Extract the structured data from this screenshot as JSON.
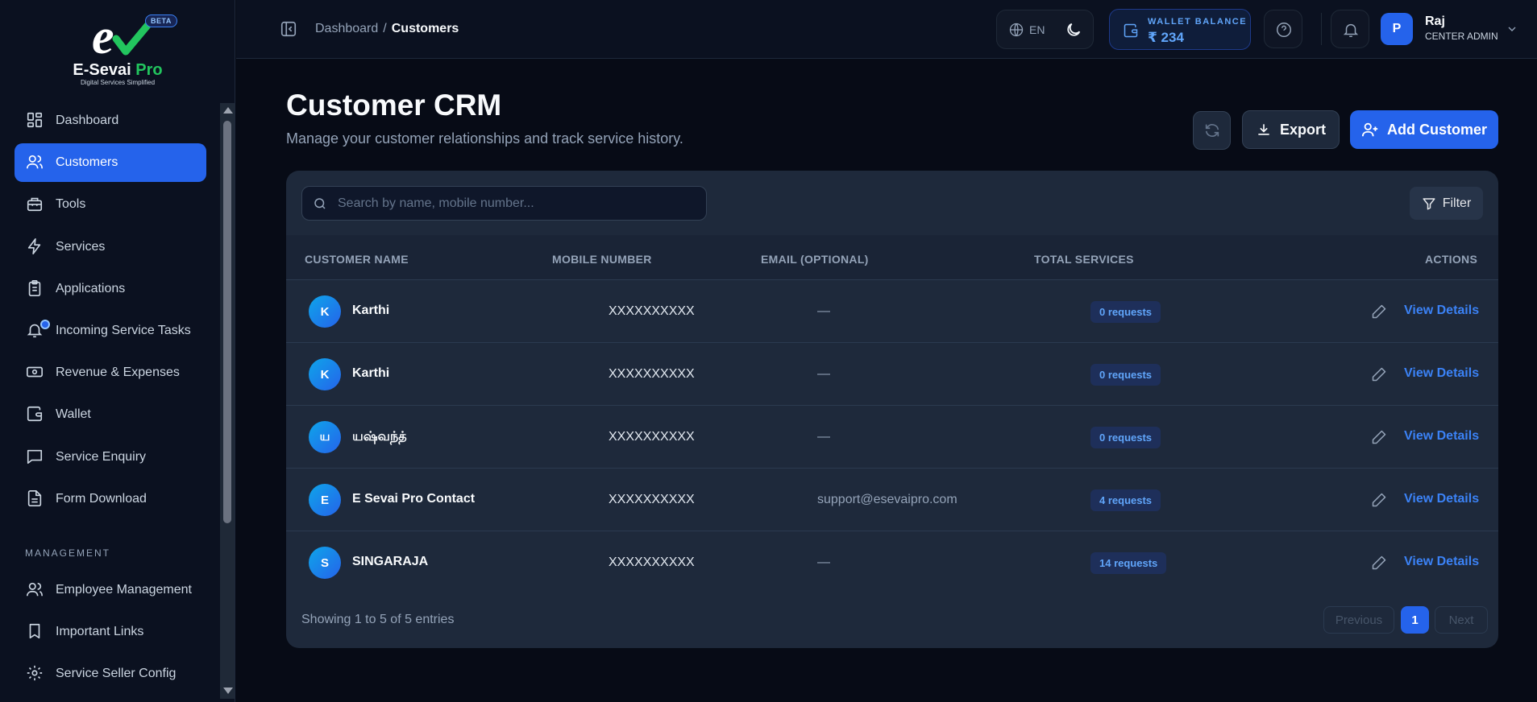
{
  "brand": {
    "name": "E-Sevai",
    "name_suffix": "Pro",
    "tagline": "Digital Services Simplified",
    "badge": "BETA",
    "accent": "#2563eb",
    "green": "#22c55e"
  },
  "sidebar": {
    "items": [
      {
        "label": "Dashboard",
        "icon": "dashboard-icon"
      },
      {
        "label": "Customers",
        "icon": "users-icon",
        "active": true
      },
      {
        "label": "Tools",
        "icon": "toolbox-icon"
      },
      {
        "label": "Services",
        "icon": "bolt-icon"
      },
      {
        "label": "Applications",
        "icon": "clipboard-icon"
      },
      {
        "label": "Incoming Service Tasks",
        "icon": "bell-icon",
        "has_dot": true
      },
      {
        "label": "Revenue & Expenses",
        "icon": "banknote-icon"
      },
      {
        "label": "Wallet",
        "icon": "wallet-icon"
      },
      {
        "label": "Service Enquiry",
        "icon": "message-icon"
      },
      {
        "label": "Form Download",
        "icon": "file-icon"
      }
    ],
    "section_label": "MANAGEMENT",
    "management_items": [
      {
        "label": "Employee Management",
        "icon": "users-icon"
      },
      {
        "label": "Important Links",
        "icon": "bookmark-icon"
      },
      {
        "label": "Service Seller Config",
        "icon": "gear-icon"
      }
    ]
  },
  "header": {
    "breadcrumb": {
      "parent": "Dashboard",
      "separator": "/",
      "current": "Customers"
    },
    "language": "EN",
    "wallet": {
      "label": "WALLET BALANCE",
      "value": "₹ 234"
    },
    "user": {
      "initial": "P",
      "name": "Raj",
      "role": "CENTER ADMIN"
    }
  },
  "page": {
    "title": "Customer CRM",
    "subtitle": "Manage your customer relationships and track service history.",
    "export_label": "Export",
    "add_label": "Add Customer"
  },
  "table": {
    "search_placeholder": "Search by name, mobile number...",
    "filter_label": "Filter",
    "columns": [
      "CUSTOMER NAME",
      "MOBILE NUMBER",
      "EMAIL (OPTIONAL)",
      "TOTAL SERVICES",
      "ACTIONS"
    ],
    "rows": [
      {
        "initial": "K",
        "name": "Karthi",
        "mobile": "XXXXXXXXXX",
        "email": "—",
        "services": "0 requests",
        "action": "View Details"
      },
      {
        "initial": "K",
        "name": "Karthi",
        "mobile": "XXXXXXXXXX",
        "email": "—",
        "services": "0 requests",
        "action": "View Details"
      },
      {
        "initial": "ய",
        "name": "யஷ்வந்த்",
        "mobile": "XXXXXXXXXX",
        "email": "—",
        "services": "0 requests",
        "action": "View Details"
      },
      {
        "initial": "E",
        "name": "E Sevai Pro Contact",
        "mobile": "XXXXXXXXXX",
        "email": "support@esevaipro.com",
        "services": "4 requests",
        "action": "View Details"
      },
      {
        "initial": "S",
        "name": "SINGARAJA",
        "mobile": "XXXXXXXXXX",
        "email": "—",
        "services": "14 requests",
        "action": "View Details"
      }
    ],
    "showing": "Showing 1 to 5 of 5 entries",
    "pagination": {
      "prev": "Previous",
      "current": "1",
      "next": "Next"
    }
  }
}
